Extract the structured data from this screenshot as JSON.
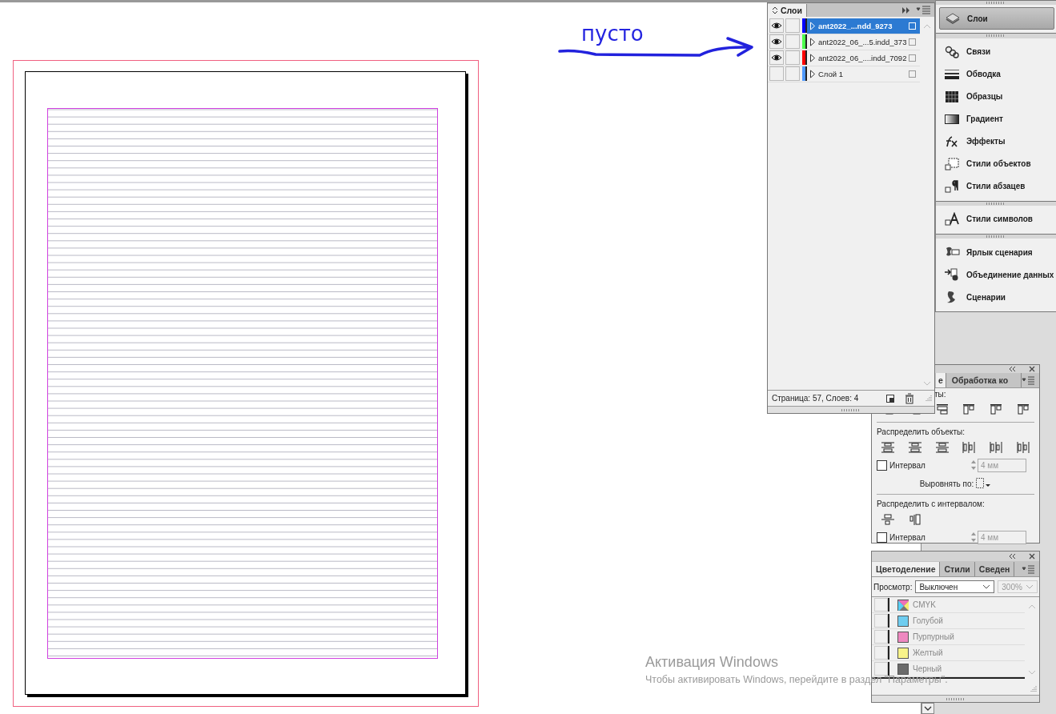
{
  "annotation": {
    "text": "пусто"
  },
  "layers_panel": {
    "tab": "Слои",
    "layers": [
      {
        "name": "ant2022_...ndd_9273",
        "visible": true,
        "color": "#0000ff",
        "selected": true
      },
      {
        "name": "ant2022_06_...5.indd_373",
        "visible": true,
        "color": "#4cff4c",
        "selected": false
      },
      {
        "name": "ant2022_06_....indd_7092",
        "visible": true,
        "color": "#ff0000",
        "selected": false
      },
      {
        "name": "Слой 1",
        "visible": false,
        "color": "#4f99ff",
        "selected": false
      }
    ],
    "status": "Страница: 57, Слоев: 4"
  },
  "dock": {
    "groups": [
      [
        {
          "label": "Слои",
          "selected": true
        }
      ],
      [
        {
          "label": "Связи",
          "selected": false
        },
        {
          "label": "Обводка",
          "selected": false
        },
        {
          "label": "Образцы",
          "selected": false
        },
        {
          "label": "Градиент",
          "selected": false
        },
        {
          "label": "Эффекты",
          "selected": false
        },
        {
          "label": "Стили объектов",
          "selected": false
        },
        {
          "label": "Стили абзацев",
          "selected": false
        }
      ],
      [
        {
          "label": "Стили символов",
          "selected": false
        }
      ],
      [
        {
          "label": "Ярлык сценария",
          "selected": false
        },
        {
          "label": "Объединение данных",
          "selected": false
        },
        {
          "label": "Сценарии",
          "selected": false
        }
      ]
    ]
  },
  "align_panel": {
    "tabs": [
      {
        "label": "е",
        "selected": true
      },
      {
        "label": "Обработка ко",
        "selected": false
      }
    ],
    "align_label": "ты:",
    "distribute_label": "Распределить объекты:",
    "spacing": {
      "label": "Интервал",
      "checked": false,
      "value": "4 мм"
    },
    "align_to_label": "Выровнять по:",
    "distribute_spacing_label": "Распределить с интервалом:",
    "spacing_2": {
      "label": "Интервал",
      "checked": false,
      "value": "4 мм"
    }
  },
  "separations_panel": {
    "tabs": [
      {
        "label": "Цветоделение",
        "selected": true
      },
      {
        "label": "Стили",
        "selected": false
      },
      {
        "label": "Сведен",
        "selected": false
      }
    ],
    "preview_label": "Просмотр:",
    "preview_value": "Выключен",
    "zoom_value": "300%",
    "inks": [
      {
        "name": "CMYK",
        "kind": "process"
      },
      {
        "name": "Голубой",
        "kind": "spot",
        "color": "#6fcdf0"
      },
      {
        "name": "Пурпурный",
        "kind": "spot",
        "color": "#ee88c0"
      },
      {
        "name": "Желтый",
        "kind": "spot",
        "color": "#f8f38a"
      },
      {
        "name": "Черный",
        "kind": "spot",
        "color": "#6b6b6b"
      }
    ]
  },
  "activation": {
    "title": "Активация Windows",
    "message": "Чтобы активировать Windows, перейдите в раздел \"Параметры\"."
  }
}
